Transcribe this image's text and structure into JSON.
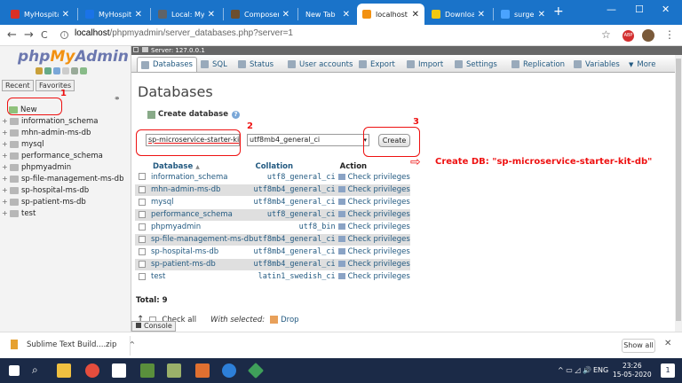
{
  "browser": {
    "tabs": [
      {
        "label": "MyHospital",
        "close": "✕",
        "color": "#d93025"
      },
      {
        "label": "MyHospital",
        "close": "✕",
        "color": "#1a73e8"
      },
      {
        "label": "Local: MyHo",
        "close": "✕",
        "color": "#5f6368"
      },
      {
        "label": "Composer",
        "close": "✕",
        "color": "#6c4e2e"
      },
      {
        "label": "New Tab",
        "close": "✕",
        "color": "#1a73c9"
      },
      {
        "label": "localhost / ",
        "close": "✕",
        "color": "#f29111"
      },
      {
        "label": "Download",
        "close": "✕",
        "color": "#f2c811"
      },
      {
        "label": "surgeryplan",
        "close": "✕",
        "color": "#4aa3ff"
      }
    ],
    "new_tab": "+",
    "url_host": "localhost",
    "url_path": "/phpmyadmin/server_databases.php?server=1",
    "nav_back": "←",
    "nav_forward": "→",
    "nav_reload": "C",
    "star": "☆",
    "ext_badge": "ABP",
    "menu": "⋮",
    "win_min": "—",
    "win_max": "☐",
    "win_close": "✕"
  },
  "left": {
    "logo_php": "php",
    "logo_my": "My",
    "logo_admin": "Admin",
    "recent": "Recent",
    "favorites": "Favorites",
    "link_icon": "⚭",
    "tree": [
      {
        "label": "New",
        "exp": "",
        "kind": "new"
      },
      {
        "label": "information_schema",
        "exp": "+",
        "kind": "db"
      },
      {
        "label": "mhn-admin-ms-db",
        "exp": "+",
        "kind": "db"
      },
      {
        "label": "mysql",
        "exp": "+",
        "kind": "db"
      },
      {
        "label": "performance_schema",
        "exp": "+",
        "kind": "db"
      },
      {
        "label": "phpmyadmin",
        "exp": "+",
        "kind": "db"
      },
      {
        "label": "sp-file-management-ms-db",
        "exp": "+",
        "kind": "db"
      },
      {
        "label": "sp-hospital-ms-db",
        "exp": "+",
        "kind": "db"
      },
      {
        "label": "sp-patient-ms-db",
        "exp": "+",
        "kind": "db"
      },
      {
        "label": "test",
        "exp": "+",
        "kind": "db"
      }
    ]
  },
  "annotations": {
    "n1": "1",
    "n2": "2",
    "n3": "3",
    "arrow": "⇨",
    "text": "Create DB: \"sp-microservice-starter-kit-db\""
  },
  "main": {
    "server": "Server: 127.0.0.1",
    "collapse": "⊼",
    "tabs": [
      "Databases",
      "SQL",
      "Status",
      "User accounts",
      "Export",
      "Import",
      "Settings",
      "Replication",
      "Variables",
      "More"
    ],
    "more_arrow": "▼",
    "title": "Databases",
    "create_label": "Create database",
    "help": "?",
    "db_name_value": "sp-microservice-starter-kit-db",
    "collation_value": "utf8mb4_general_ci",
    "select_arrow": "▾",
    "create_button": "Create",
    "table_headers": {
      "database": "Database",
      "sort": "▲",
      "collation": "Collation",
      "action": "Action"
    },
    "rows": [
      {
        "name": "information_schema",
        "collation": "utf8_general_ci",
        "action": "Check privileges"
      },
      {
        "name": "mhn-admin-ms-db",
        "collation": "utf8mb4_general_ci",
        "action": "Check privileges"
      },
      {
        "name": "mysql",
        "collation": "utf8mb4_general_ci",
        "action": "Check privileges"
      },
      {
        "name": "performance_schema",
        "collation": "utf8_general_ci",
        "action": "Check privileges"
      },
      {
        "name": "phpmyadmin",
        "collation": "utf8_bin",
        "action": "Check privileges"
      },
      {
        "name": "sp-file-management-ms-db",
        "collation": "utf8mb4_general_ci",
        "action": "Check privileges"
      },
      {
        "name": "sp-hospital-ms-db",
        "collation": "utf8mb4_general_ci",
        "action": "Check privileges"
      },
      {
        "name": "sp-patient-ms-db",
        "collation": "utf8mb4_general_ci",
        "action": "Check privileges"
      },
      {
        "name": "test",
        "collation": "latin1_swedish_ci",
        "action": "Check privileges"
      }
    ],
    "total": "Total: 9",
    "check_all": "Check all",
    "with_selected": "With selected:",
    "drop": "Drop",
    "console": "Console"
  },
  "downloads": {
    "item": "Sublime Text Build....zip",
    "chevron": "^",
    "show_all": "Show all",
    "close": "✕"
  },
  "taskbar": {
    "search": "⌕",
    "tray": "^ ▭ ◿ 🔊",
    "lang": "ENG",
    "time": "23:26",
    "date": "15-05-2020",
    "notifications": "1"
  }
}
